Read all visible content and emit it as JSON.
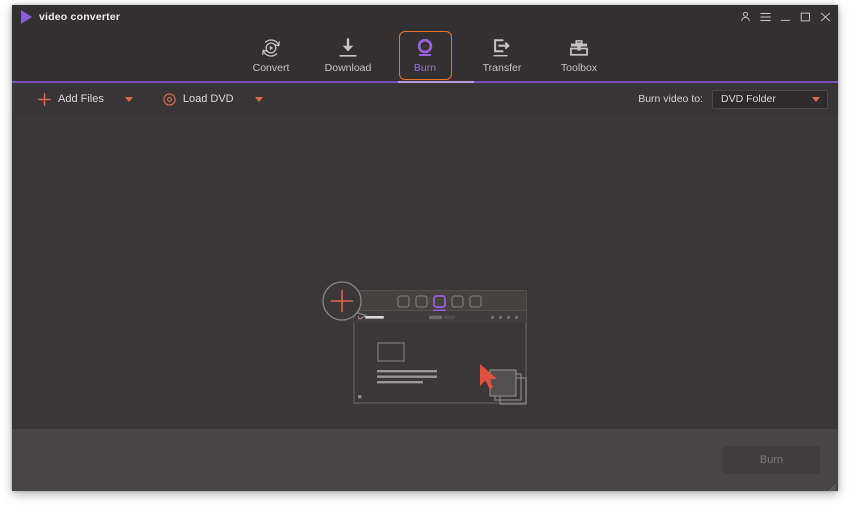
{
  "app": {
    "title": "video converter",
    "logo_icon": "play-triangle-logo"
  },
  "window_controls": [
    {
      "name": "account-icon",
      "label": "Account"
    },
    {
      "name": "menu-icon",
      "label": "Menu"
    },
    {
      "name": "minimize-icon",
      "label": "Minimize"
    },
    {
      "name": "maximize-icon",
      "label": "Maximize"
    },
    {
      "name": "close-icon",
      "label": "Close"
    }
  ],
  "tabs": [
    {
      "label": "Convert",
      "icon": "convert-icon",
      "active": false
    },
    {
      "label": "Download",
      "icon": "download-icon",
      "active": false
    },
    {
      "label": "Burn",
      "icon": "disc-icon",
      "active": true
    },
    {
      "label": "Transfer",
      "icon": "transfer-icon",
      "active": false
    },
    {
      "label": "Toolbox",
      "icon": "toolbox-icon",
      "active": false
    }
  ],
  "toolbar": {
    "add_files_label": "Add Files",
    "add_files_icon": "plus-icon",
    "add_files_caret_icon": "chevron-down-icon",
    "load_dvd_label": "Load DVD",
    "load_dvd_icon": "disc-small-icon",
    "load_dvd_caret_icon": "chevron-down-icon",
    "burn_to_label": "Burn video to:",
    "burn_to_value": "DVD Folder",
    "burn_to_caret_icon": "chevron-down-icon",
    "burn_to_options": [
      "DVD Folder"
    ]
  },
  "content": {
    "dropzone_icon": "add-files-illustration",
    "plus_icon": "plus-circle-icon",
    "cursor_icon": "drag-cursor-icon",
    "files_icon": "file-stack-icon"
  },
  "footer": {
    "burn_button_label": "Burn",
    "burn_button_enabled": false,
    "resize_grip_icon": "resize-grip-icon"
  },
  "colors": {
    "accent_purple": "#8b5cd6",
    "accent_orange": "#e8762a",
    "accent_salmon": "#e06a4a",
    "titlebar_bg": "#333031",
    "content_bg": "#3a3738",
    "footer_bg": "#484546"
  }
}
